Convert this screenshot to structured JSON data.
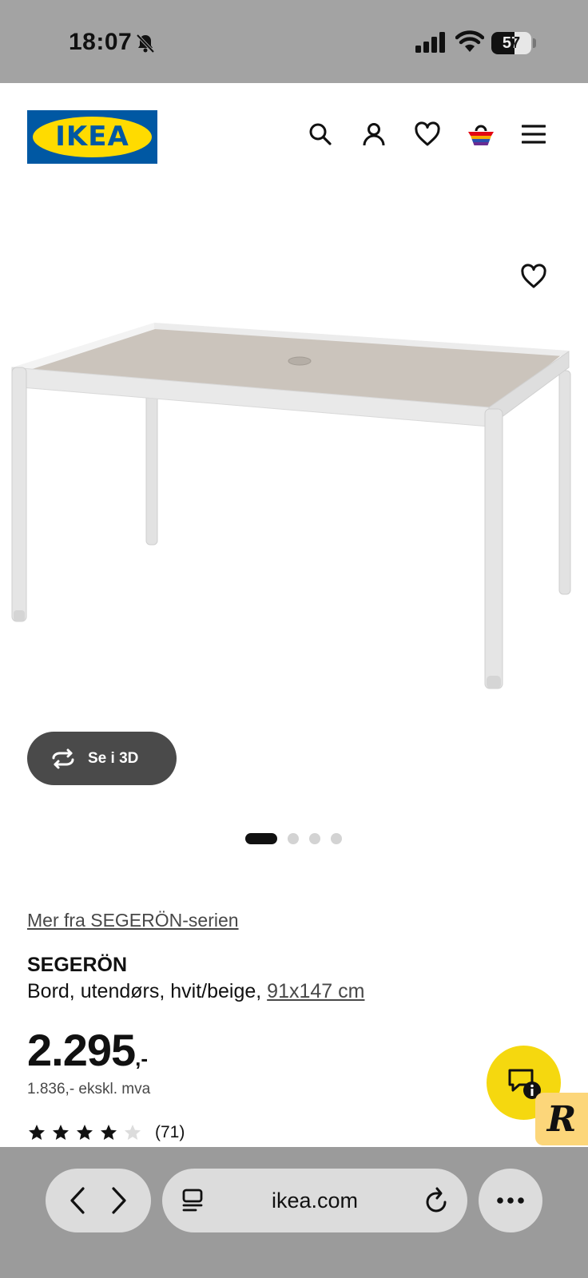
{
  "status_bar": {
    "time": "18:07",
    "battery_level": "57",
    "battery_fraction": 0.57
  },
  "header": {
    "logo_text": "IKEA",
    "icons": [
      "search-icon",
      "account-icon",
      "heart-icon",
      "cart-icon",
      "menu-icon"
    ]
  },
  "product": {
    "view_3d_label": "Se i 3D",
    "carousel_count": 4,
    "carousel_active": 1,
    "series_link": "Mer fra SEGERÖN-serien",
    "name": "SEGERÖN",
    "description": "Bord, utendørs, hvit/beige, ",
    "size": "91x147 cm",
    "price_main": "2.295",
    "price_suffix": ",-",
    "price_ex_vat": "1.836,- ekskl. mva",
    "rating_value": 4,
    "rating_max": 5,
    "rating_count": "(71)"
  },
  "floating": {
    "badge_letter": "R"
  },
  "browser": {
    "url": "ikea.com"
  },
  "colors": {
    "ikea_blue": "#0058a3",
    "ikea_yellow": "#ffdb00",
    "chat_yellow": "#f5d80f"
  }
}
